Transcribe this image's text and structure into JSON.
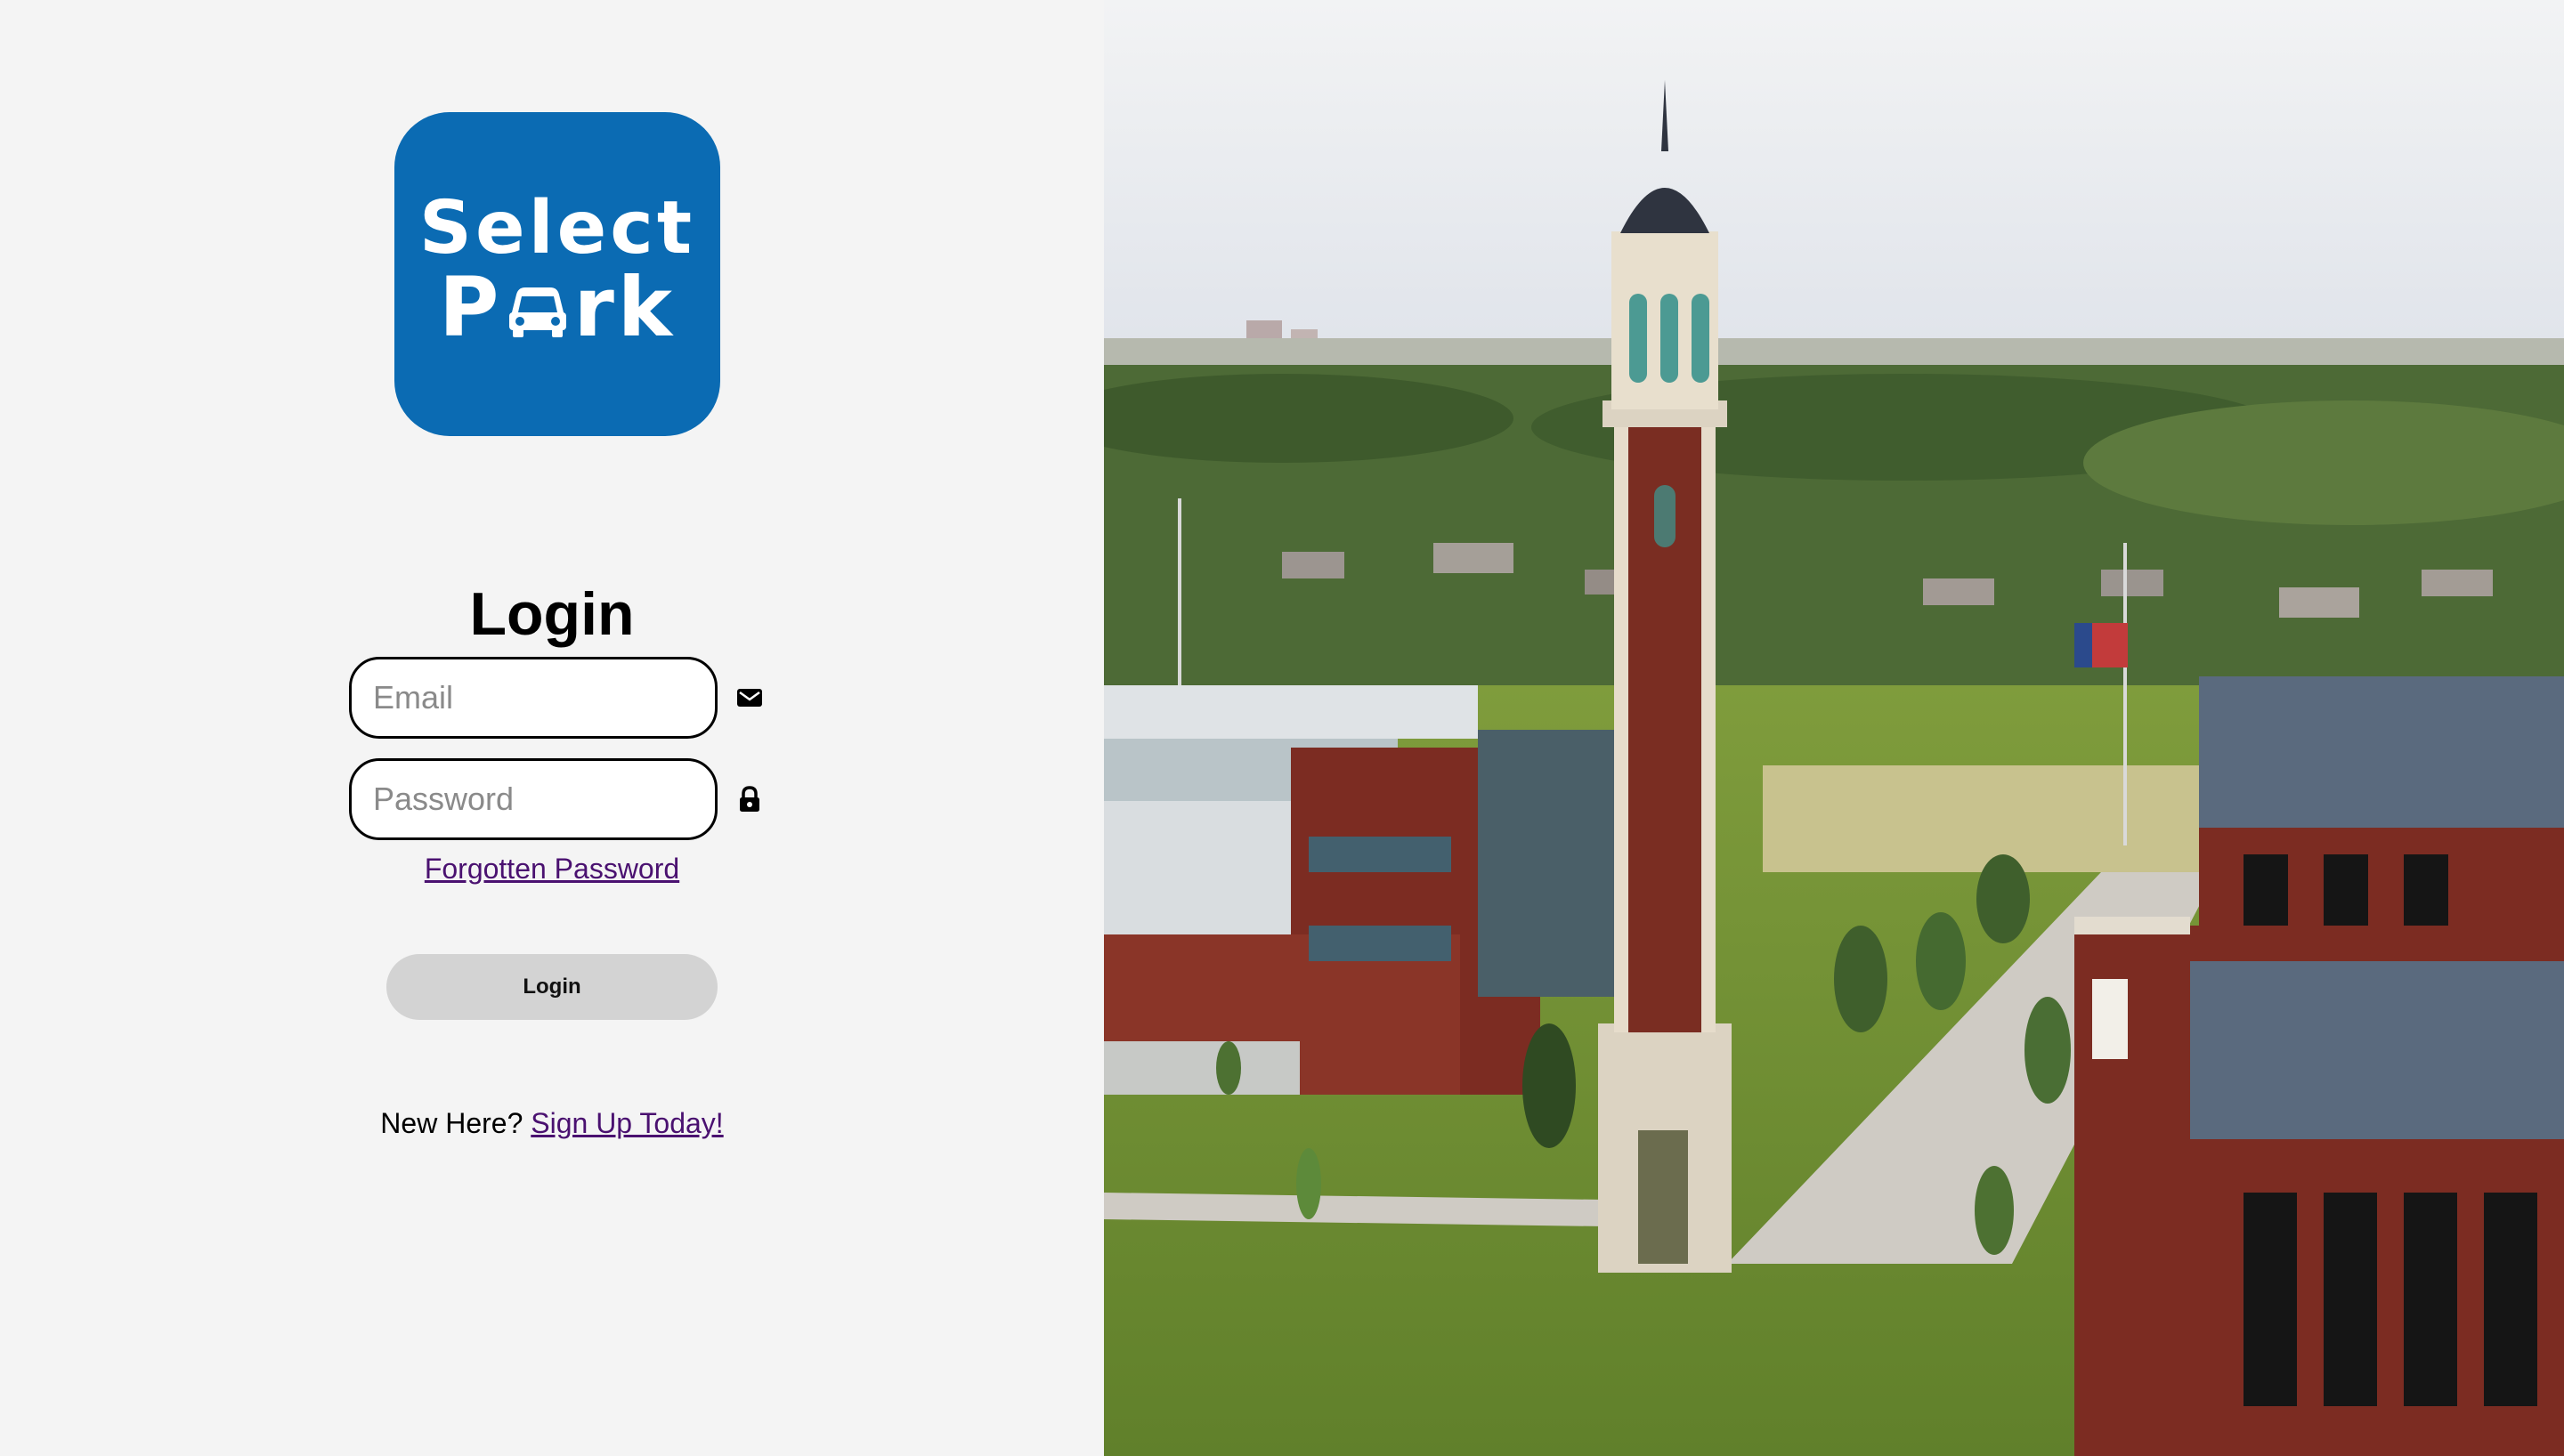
{
  "logo": {
    "line1": "Select",
    "line2_start": "P",
    "line2_end": "rk",
    "icon": "car-icon",
    "brand_color": "#0b6bb3"
  },
  "login": {
    "title": "Login",
    "email_placeholder": "Email",
    "email_icon": "envelope-icon",
    "password_placeholder": "Password",
    "password_icon": "lock-icon",
    "forgot_link": "Forgotten Password",
    "submit_label": "Login",
    "new_here_text": "New Here?",
    "signup_link": "Sign Up Today!"
  },
  "colors": {
    "background": "#f4f4f4",
    "link": "#4a1170",
    "button": "#d3d3d3"
  },
  "hero_image": "campus-clock-tower-image"
}
